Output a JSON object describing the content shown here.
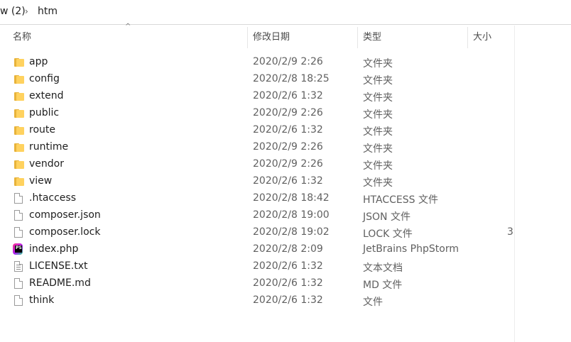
{
  "address_bar": {
    "prev_segment": "w (2)",
    "separator": "›",
    "current_segment": "htm"
  },
  "columns": {
    "name": "名称",
    "date": "修改日期",
    "type": "类型",
    "size": "大小",
    "sort_indicator": "^"
  },
  "files": [
    {
      "name": "app",
      "date": "2020/2/9 2:26",
      "type": "文件夹",
      "size": "",
      "icon": "folder-icon"
    },
    {
      "name": "config",
      "date": "2020/2/8 18:25",
      "type": "文件夹",
      "size": "",
      "icon": "folder-icon"
    },
    {
      "name": "extend",
      "date": "2020/2/6 1:32",
      "type": "文件夹",
      "size": "",
      "icon": "folder-icon"
    },
    {
      "name": "public",
      "date": "2020/2/9 2:26",
      "type": "文件夹",
      "size": "",
      "icon": "folder-icon"
    },
    {
      "name": "route",
      "date": "2020/2/6 1:32",
      "type": "文件夹",
      "size": "",
      "icon": "folder-icon"
    },
    {
      "name": "runtime",
      "date": "2020/2/9 2:26",
      "type": "文件夹",
      "size": "",
      "icon": "folder-icon"
    },
    {
      "name": "vendor",
      "date": "2020/2/9 2:26",
      "type": "文件夹",
      "size": "",
      "icon": "folder-icon"
    },
    {
      "name": "view",
      "date": "2020/2/6 1:32",
      "type": "文件夹",
      "size": "",
      "icon": "folder-icon"
    },
    {
      "name": ".htaccess",
      "date": "2020/2/8 18:42",
      "type": "HTACCESS 文件",
      "size": "",
      "icon": "file-icon"
    },
    {
      "name": "composer.json",
      "date": "2020/2/8 19:00",
      "type": "JSON 文件",
      "size": "",
      "icon": "file-icon"
    },
    {
      "name": "composer.lock",
      "date": "2020/2/8 19:02",
      "type": "LOCK 文件",
      "size": "3",
      "icon": "file-icon"
    },
    {
      "name": "index.php",
      "date": "2020/2/8 2:09",
      "type": "JetBrains PhpStorm",
      "size": "",
      "icon": "phpstorm-icon"
    },
    {
      "name": "LICENSE.txt",
      "date": "2020/2/6 1:32",
      "type": "文本文档",
      "size": "",
      "icon": "text-file-icon"
    },
    {
      "name": "README.md",
      "date": "2020/2/6 1:32",
      "type": "MD 文件",
      "size": "",
      "icon": "file-icon"
    },
    {
      "name": "think",
      "date": "2020/2/6 1:32",
      "type": "文件",
      "size": "",
      "icon": "file-icon"
    }
  ],
  "phpstorm_icon_label": "PS",
  "colors": {
    "folder": "#ffd25f",
    "folder_back": "#e8b33a",
    "text_primary": "#1e1e1e",
    "text_secondary": "#606060"
  }
}
